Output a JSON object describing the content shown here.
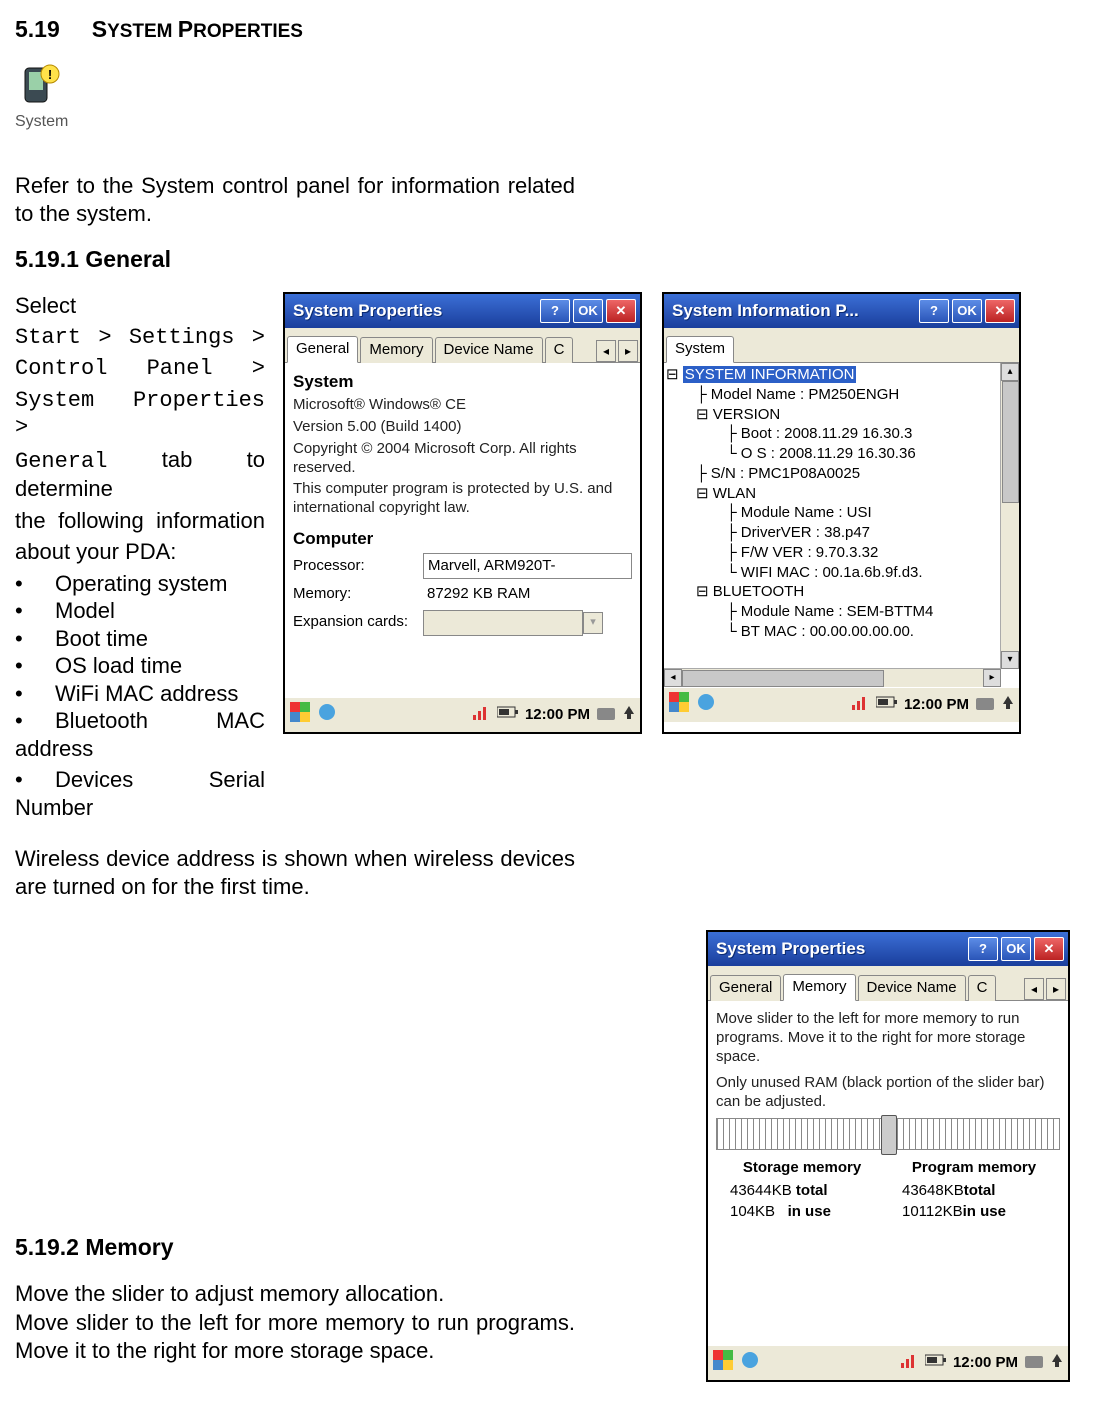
{
  "section": {
    "number": "5.19",
    "title_smallcaps_1": "S",
    "title_rest_1": "YSTEM ",
    "title_smallcaps_2": "P",
    "title_rest_2": "ROPERTIES"
  },
  "system_icon_label": "System",
  "intro": "Refer to the System control panel for information related to the system.",
  "sub1": {
    "heading": "5.19.1 General",
    "select": "Select",
    "path1": "Start > Settings >",
    "path2": "Control Panel >",
    "path3": "System Properties >",
    "path4a": "General",
    "path4b": " tab to determine",
    "line5": "the following information",
    "line6": "about your PDA:",
    "bullets": [
      "Operating system",
      "Model",
      "Boot time",
      "OS load time",
      "WiFi MAC address"
    ],
    "bullet_bt_a": "Bluetooth",
    "bullet_bt_b": "MAC",
    "bullet_bt_c": "address",
    "bullet_dev_a": "Devices",
    "bullet_dev_b": "Serial",
    "bullet_dev_c": "Number",
    "wireless": "Wireless device address is shown when wireless devices are turned on for the first time."
  },
  "sub2": {
    "heading": "5.19.2 Memory",
    "p1": "Move the slider to adjust memory allocation.",
    "p2": "Move slider to the left for more memory to run programs. Move it to the right for more storage space."
  },
  "win_sysprops": {
    "title": "System Properties",
    "help": "?",
    "ok": "OK",
    "close": "✕",
    "tabs": [
      "General",
      "Memory",
      "Device Name",
      "C"
    ],
    "nav_left": "◂",
    "nav_right": "▸",
    "h_system": "System",
    "sys_line1": "Microsoft® Windows® CE",
    "sys_line2": "Version 5.00 (Build 1400)",
    "sys_line3": "Copyright © 2004 Microsoft Corp. All rights reserved.",
    "sys_line4": "This computer program is protected by U.S. and international copyright law.",
    "h_computer": "Computer",
    "proc_lbl": "Processor:",
    "proc_val": "Marvell, ARM920T-",
    "mem_lbl": "Memory:",
    "mem_val": "87292 KB  RAM",
    "exp_lbl": "Expansion cards:",
    "exp_val": "",
    "clock": "12:00 PM"
  },
  "win_sysinfo": {
    "title": "System Information P...",
    "help": "?",
    "ok": "OK",
    "close": "✕",
    "tab": "System",
    "root": "SYSTEM INFORMATION",
    "model": "Model Name : PM250ENGH",
    "version": "VERSION",
    "boot": "Boot : 2008.11.29  16.30.3",
    "os": "O  S : 2008.11.29  16.30.36",
    "sn": "S/N : PMC1P08A0025",
    "wlan": "WLAN",
    "wlan_mod": "Module Name : USI",
    "wlan_drv": "DriverVER : 38.p47",
    "wlan_fw": "F/W  VER : 9.70.3.32",
    "wlan_mac": "WIFI MAC : 00.1a.6b.9f.d3.",
    "bt": "BLUETOOTH",
    "bt_mod": "Module Name : SEM-BTTM4",
    "bt_mac": "BT   MAC : 00.00.00.00.00.",
    "clock": "12:00 PM"
  },
  "win_mem": {
    "title": "System Properties",
    "help": "?",
    "ok": "OK",
    "close": "✕",
    "tabs": [
      "General",
      "Memory",
      "Device Name",
      "C"
    ],
    "nav_left": "◂",
    "nav_right": "▸",
    "desc1": "Move slider to the left for more memory to run programs. Move it to the right for more storage space.",
    "desc2": "Only unused RAM (black portion of the slider bar) can be adjusted.",
    "col1_head": "Storage memory",
    "col2_head": "Program memory",
    "s_total": "43644KB",
    "s_total_lbl": "total",
    "s_inuse": "104KB",
    "s_inuse_lbl": "in use",
    "p_total": "43648KB",
    "p_total_lbl": "total",
    "p_inuse": "10112KB",
    "p_inuse_lbl": "in use",
    "clock": "12:00 PM"
  }
}
